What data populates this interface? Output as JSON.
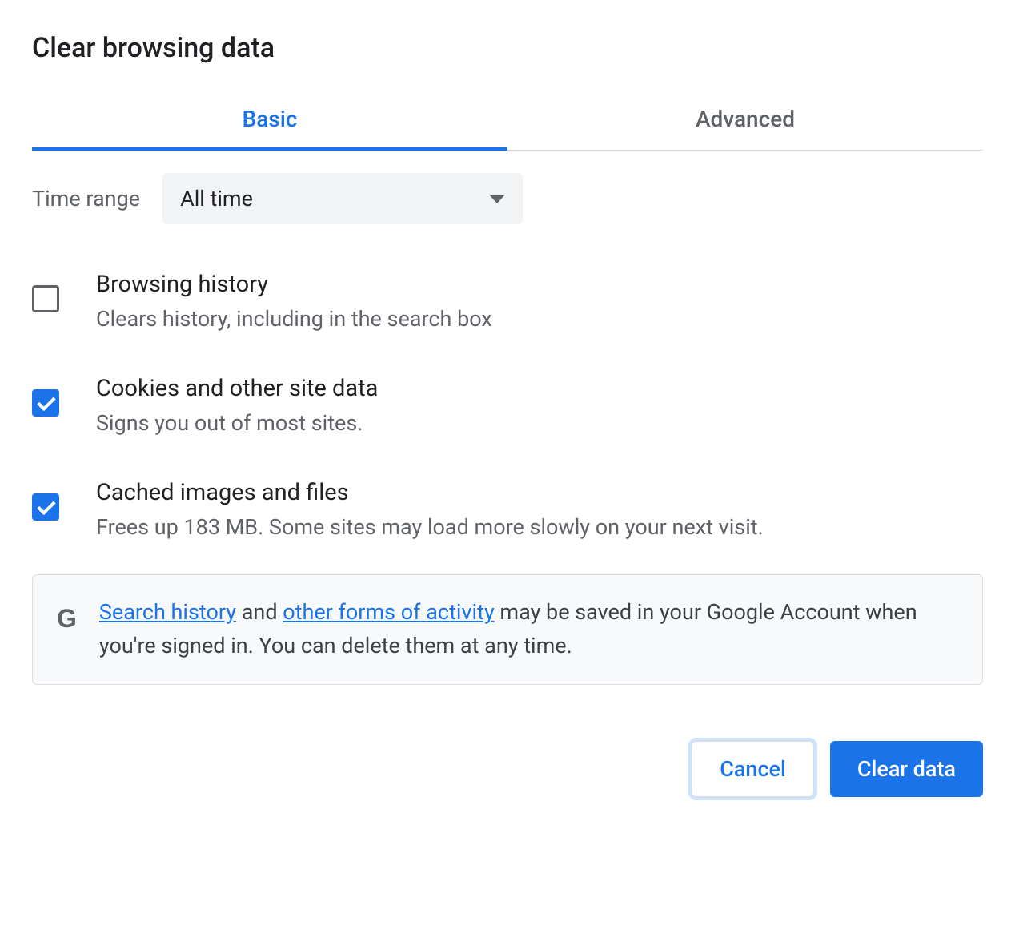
{
  "title": "Clear browsing data",
  "tabs": {
    "basic": "Basic",
    "advanced": "Advanced"
  },
  "timeRange": {
    "label": "Time range",
    "value": "All time"
  },
  "options": [
    {
      "title": "Browsing history",
      "desc": "Clears history, including in the search box",
      "checked": false
    },
    {
      "title": "Cookies and other site data",
      "desc": "Signs you out of most sites.",
      "checked": true
    },
    {
      "title": "Cached images and files",
      "desc": "Frees up 183 MB. Some sites may load more slowly on your next visit.",
      "checked": true
    }
  ],
  "info": {
    "link1": "Search history",
    "text1": " and ",
    "link2": "other forms of activity",
    "text2": " may be saved in your Google Account when you're signed in. You can delete them at any time."
  },
  "buttons": {
    "cancel": "Cancel",
    "clear": "Clear data"
  }
}
